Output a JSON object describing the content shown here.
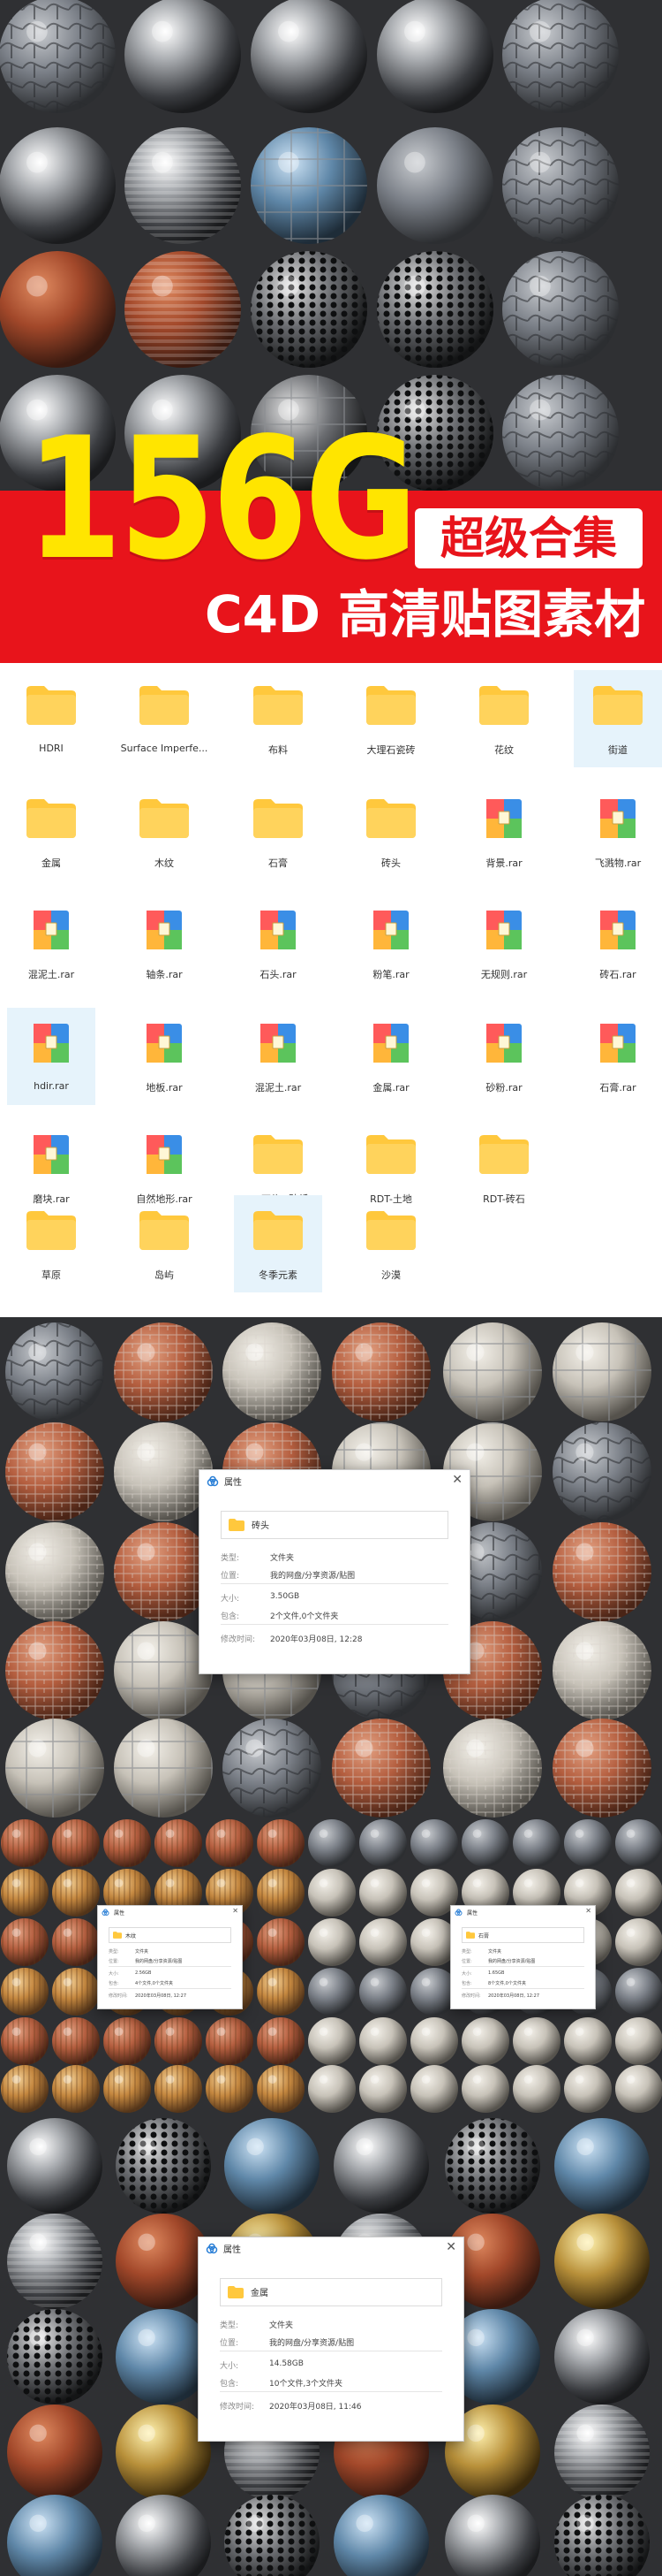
{
  "hero": {
    "big_title": "156G",
    "badge": "超级合集",
    "subtitle": "C4D 高清贴图素材"
  },
  "colors": {
    "banner_red": "#e8141b",
    "title_yellow": "#ffe500",
    "dark_bg": "#2f3033",
    "folder_yellow": "#ffc83d",
    "selected_bg": "#e6f3fb"
  },
  "folders": [
    {
      "label": "HDRI",
      "type": "folder"
    },
    {
      "label": "Surface Imperfe...",
      "type": "folder"
    },
    {
      "label": "布料",
      "type": "folder"
    },
    {
      "label": "大理石瓷砖",
      "type": "folder"
    },
    {
      "label": "花纹",
      "type": "folder"
    },
    {
      "label": "街道",
      "type": "folder",
      "selected": true
    },
    {
      "label": "金属",
      "type": "folder"
    },
    {
      "label": "木纹",
      "type": "folder"
    },
    {
      "label": "石膏",
      "type": "folder"
    },
    {
      "label": "砖头",
      "type": "folder"
    },
    {
      "label": "背景.rar",
      "type": "archive"
    },
    {
      "label": "飞溅物.rar",
      "type": "archive"
    },
    {
      "label": "混泥土.rar",
      "type": "archive"
    },
    {
      "label": "轴条.rar",
      "type": "archive"
    },
    {
      "label": "石头.rar",
      "type": "archive"
    },
    {
      "label": "粉笔.rar",
      "type": "archive"
    },
    {
      "label": "无规则.rar",
      "type": "archive"
    },
    {
      "label": "砖石.rar",
      "type": "archive"
    },
    {
      "label": "hdir.rar",
      "type": "archive",
      "selected": true
    },
    {
      "label": "地板.rar",
      "type": "archive"
    },
    {
      "label": "混泥土.rar",
      "type": "archive"
    },
    {
      "label": "金属.rar",
      "type": "archive"
    },
    {
      "label": "砂粉.rar",
      "type": "archive"
    },
    {
      "label": "石膏.rar",
      "type": "archive"
    },
    {
      "label": "磨块.rar",
      "type": "archive"
    },
    {
      "label": "自然地形.rar",
      "type": "archive"
    },
    {
      "label": "RDT-石头+砂纸...",
      "type": "folder"
    },
    {
      "label": "RDT-土地",
      "type": "folder"
    },
    {
      "label": "RDT-砖石",
      "type": "folder"
    },
    {
      "label": "草原",
      "type": "folder"
    },
    {
      "label": "岛屿",
      "type": "folder"
    },
    {
      "label": "冬季元素",
      "type": "folder",
      "selected": true
    },
    {
      "label": "沙漠",
      "type": "folder"
    }
  ],
  "dialogs": {
    "brick": {
      "title": "属性",
      "name": "砖头",
      "rows": [
        {
          "k": "类型:",
          "v": "文件夹"
        },
        {
          "k": "位置:",
          "v": "我的网盘/分享资源/贴图"
        },
        {
          "k": "大小:",
          "v": "3.50GB"
        },
        {
          "k": "包含:",
          "v": "2个文件,0个文件夹"
        },
        {
          "k": "修改时间:",
          "v": "2020年03月08日, 12:28"
        }
      ]
    },
    "wood": {
      "title": "属性",
      "name": "木纹",
      "rows": [
        {
          "k": "类型:",
          "v": "文件夹"
        },
        {
          "k": "位置:",
          "v": "我的网盘/分享资源/贴图"
        },
        {
          "k": "大小:",
          "v": "2.56GB"
        },
        {
          "k": "包含:",
          "v": "4个文件,0个文件夹"
        },
        {
          "k": "修改时间:",
          "v": "2020年03月08日, 12:27"
        }
      ]
    },
    "plaster": {
      "title": "属性",
      "name": "石膏",
      "rows": [
        {
          "k": "类型:",
          "v": "文件夹"
        },
        {
          "k": "位置:",
          "v": "我的网盘/分享资源/贴图"
        },
        {
          "k": "大小:",
          "v": "1.65GB"
        },
        {
          "k": "包含:",
          "v": "8个文件,0个文件夹"
        },
        {
          "k": "修改时间:",
          "v": "2020年03月08日, 12:27"
        }
      ]
    },
    "metal": {
      "title": "属性",
      "name": "金属",
      "rows": [
        {
          "k": "类型:",
          "v": "文件夹"
        },
        {
          "k": "位置:",
          "v": "我的网盘/分享资源/贴图"
        },
        {
          "k": "大小:",
          "v": "14.58GB"
        },
        {
          "k": "包含:",
          "v": "10个文件,3个文件夹"
        },
        {
          "k": "修改时间:",
          "v": "2020年03月08日, 11:46"
        }
      ]
    }
  }
}
